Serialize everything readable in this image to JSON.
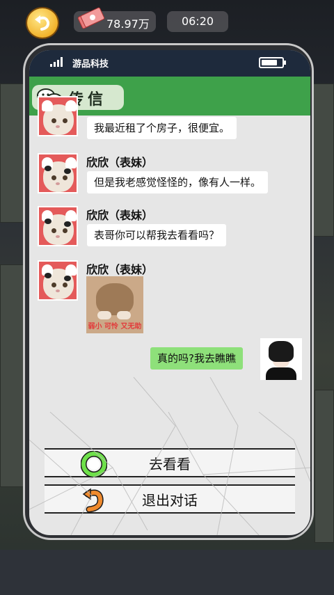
{
  "hud": {
    "money": "78.97万",
    "time": "06:20"
  },
  "phone": {
    "carrier": "游品科技",
    "app_title": "传信"
  },
  "chat": {
    "messages": [
      {
        "sender": "",
        "text": "我最近租了个房子，很便宜。"
      },
      {
        "sender": "欣欣（表妹）",
        "text": "但是我老感觉怪怪的，像有人一样。"
      },
      {
        "sender": "欣欣（表妹）",
        "text": "表哥你可以帮我去看看吗？"
      },
      {
        "sender": "欣欣（表妹）",
        "sticker_caption": "弱小 可怜 又无助"
      },
      {
        "sender": "me",
        "text": "真的吗?我去瞧瞧"
      }
    ]
  },
  "options": [
    {
      "label": "去看看",
      "icon": "green-circle-icon"
    },
    {
      "label": "退出对话",
      "icon": "orange-return-icon"
    }
  ],
  "colors": {
    "header_green": "#3ea14a",
    "my_bubble": "#8ee07a",
    "statusbar": "#1e2a3c"
  }
}
